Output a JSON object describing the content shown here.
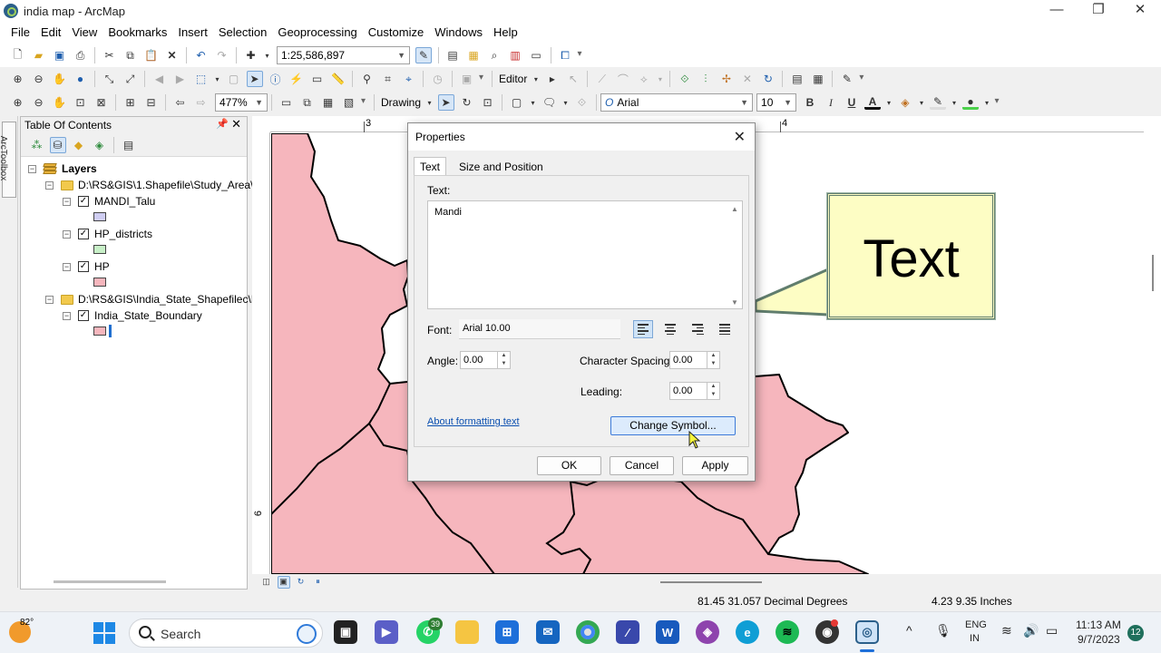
{
  "window": {
    "title": "india map - ArcMap",
    "minimize": "—",
    "maximize": "❐",
    "close": "✕"
  },
  "menu": [
    "File",
    "Edit",
    "View",
    "Bookmarks",
    "Insert",
    "Selection",
    "Geoprocessing",
    "Customize",
    "Windows",
    "Help"
  ],
  "toolbar": {
    "scale_value": "1:25,586,897",
    "zoom_value": "477%",
    "editor_label": "Editor",
    "drawing_label": "Drawing",
    "font_name": "Arial",
    "font_size": "10",
    "bold": "B",
    "italic": "I",
    "underline": "U",
    "font_color_glyph": "A"
  },
  "toolstrip": {
    "label": "ArcToolbox"
  },
  "toc": {
    "title": "Table Of Contents",
    "root": "Layers",
    "groups": [
      {
        "path": "D:\\RS&GIS\\1.Shapefile\\Study_Area\\",
        "layers": [
          {
            "name": "MANDI_Talu",
            "color": "#cfcdf2"
          },
          {
            "name": "HP_districts",
            "color": "#c8f0c8"
          },
          {
            "name": "HP",
            "color": "#f6b6bd"
          }
        ]
      },
      {
        "path": "D:\\RS&GIS\\India_State_Shapefilec\\I",
        "layers": [
          {
            "name": "India_State_Boundary",
            "color": "#f6b6bd"
          }
        ]
      }
    ]
  },
  "map": {
    "fill_color": "#f6b6bd",
    "ruler_top": [
      "3",
      "4"
    ],
    "ruler_left": [
      "6"
    ],
    "callout_text": "Text",
    "callout_color": "#fdfdc4"
  },
  "dialog": {
    "title": "Properties",
    "tabs": [
      "Text",
      "Size and Position"
    ],
    "text_label": "Text:",
    "text_value": "Mandi",
    "font_label": "Font:",
    "font_value": "Arial 10.00",
    "angle_label": "Angle:",
    "angle_value": "0.00",
    "char_spacing_label": "Character Spacing:",
    "char_spacing_value": "0.00",
    "leading_label": "Leading:",
    "leading_value": "0.00",
    "help_link": "About formatting text",
    "change_symbol": "Change Symbol...",
    "ok": "OK",
    "cancel": "Cancel",
    "apply": "Apply"
  },
  "status": {
    "coords": "81.45  31.057 Decimal Degrees",
    "page_coords": "4.23  9.35 Inches"
  },
  "taskbar": {
    "weather_temp": "82°",
    "search_label": "Search",
    "whatsapp_badge": "39",
    "lang_top": "ENG",
    "lang_bottom": "IN",
    "time": "11:13 AM",
    "date": "9/7/2023",
    "notif_count": "12"
  }
}
